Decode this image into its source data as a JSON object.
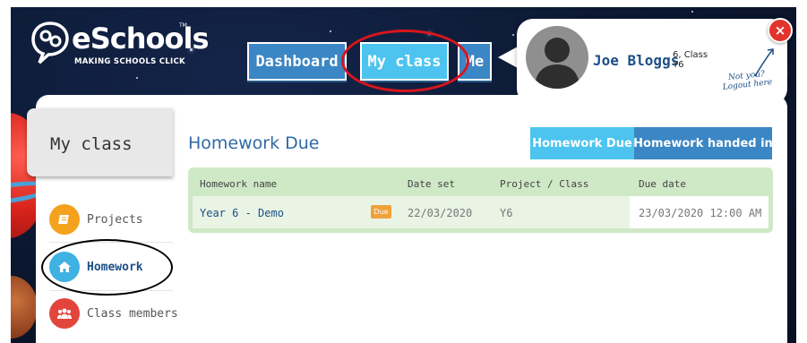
{
  "brand": {
    "name": "eSchools",
    "tagline": "MAKING SCHOOLS CLICK",
    "tm": "TM"
  },
  "topnav": {
    "items": [
      {
        "label": "Dashboard",
        "active": false
      },
      {
        "label": "My class",
        "active": true
      },
      {
        "label": "Me",
        "active": false
      }
    ]
  },
  "user": {
    "name": "Joe Bloggs",
    "class_info": "6, Class Y6",
    "logout_text": "Not you? Logout here",
    "close_label": "×"
  },
  "section_tab": {
    "label": "My class"
  },
  "sidebar": {
    "items": [
      {
        "label": "Projects",
        "icon": "folder-icon",
        "color": "#f4a21d",
        "active": false
      },
      {
        "label": "Homework",
        "icon": "home-icon",
        "color": "#3fb1e3",
        "active": true
      },
      {
        "label": "Class members",
        "icon": "users-icon",
        "color": "#e2453c",
        "active": false
      }
    ]
  },
  "content": {
    "title": "Homework Due",
    "tabs": [
      {
        "label": "Homework Due",
        "active": true
      },
      {
        "label": "Homework handed in",
        "active": false
      }
    ],
    "table": {
      "headers": [
        "Homework name",
        "Date set",
        "Project / Class",
        "Due date"
      ],
      "rows": [
        {
          "name": "Year 6 - Demo",
          "badge": "Due",
          "date_set": "22/03/2020",
          "project_class": "Y6",
          "due_date": "23/03/2020 12:00 AM"
        }
      ]
    }
  },
  "colors": {
    "accent_light": "#4cc4ef",
    "accent_dark": "#3b86c4",
    "table_header_bg": "#cfe8c6",
    "badge_due": "#f0a13a"
  }
}
